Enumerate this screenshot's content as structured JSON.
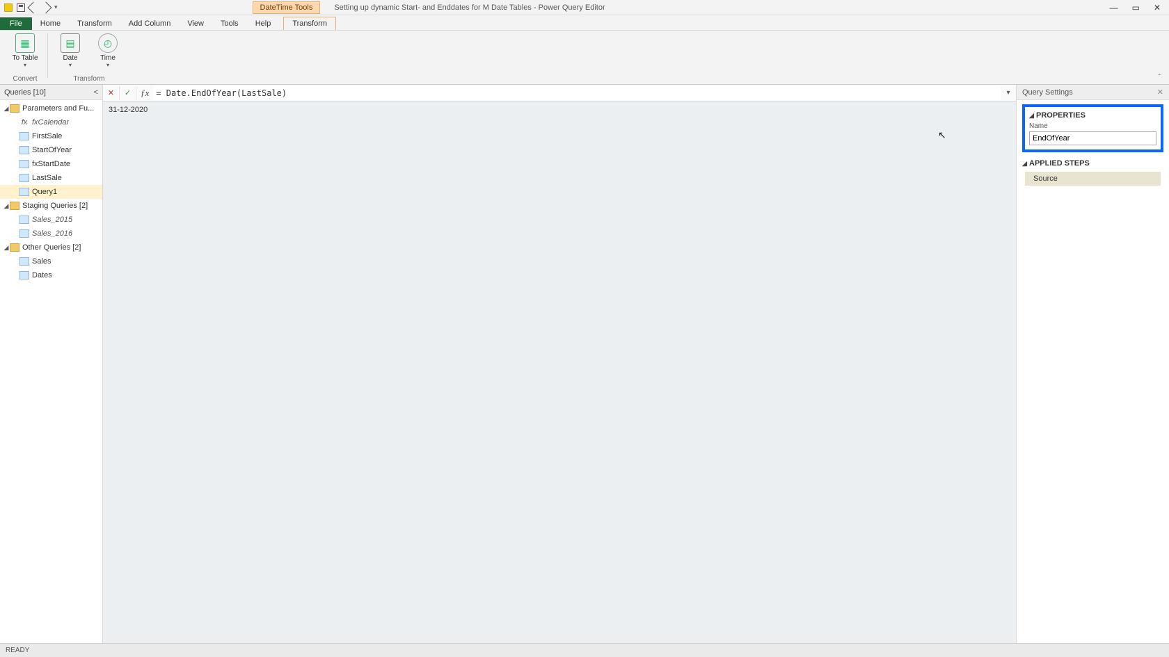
{
  "title": {
    "context_tab": "DateTime Tools",
    "window": "Setting up dynamic Start- and Enddates for M Date Tables - Power Query Editor"
  },
  "menu": {
    "file": "File",
    "home": "Home",
    "transform": "Transform",
    "addcolumn": "Add Column",
    "view": "View",
    "tools": "Tools",
    "help": "Help",
    "ctx_transform": "Transform"
  },
  "ribbon": {
    "to_table": "To\nTable",
    "date": "Date",
    "time": "Time",
    "group_convert": "Convert",
    "group_transform": "Transform"
  },
  "queries": {
    "header": "Queries [10]",
    "groups": [
      {
        "label": "Parameters and Fu...",
        "children": [
          {
            "label": "fxCalendar",
            "icon": "fx",
            "italic": true
          },
          {
            "label": "FirstSale",
            "icon": "tbl"
          },
          {
            "label": "StartOfYear",
            "icon": "tbl"
          },
          {
            "label": "fxStartDate",
            "icon": "tbl"
          },
          {
            "label": "LastSale",
            "icon": "tbl"
          },
          {
            "label": "Query1",
            "icon": "tbl",
            "selected": true
          }
        ]
      },
      {
        "label": "Staging Queries [2]",
        "children": [
          {
            "label": "Sales_2015",
            "icon": "tbl",
            "italic": true
          },
          {
            "label": "Sales_2016",
            "icon": "tbl",
            "italic": true
          }
        ]
      },
      {
        "label": "Other Queries [2]",
        "children": [
          {
            "label": "Sales",
            "icon": "tbl"
          },
          {
            "label": "Dates",
            "icon": "tbl"
          }
        ]
      }
    ]
  },
  "formula": "= Date.EndOfYear(LastSale)",
  "preview_value": "31-12-2020",
  "query_settings": {
    "header": "Query Settings",
    "properties": "PROPERTIES",
    "name_label": "Name",
    "name_value": "EndOfYear",
    "applied_steps": "APPLIED STEPS",
    "steps": [
      {
        "label": "Source",
        "selected": true
      }
    ]
  },
  "status": "READY"
}
